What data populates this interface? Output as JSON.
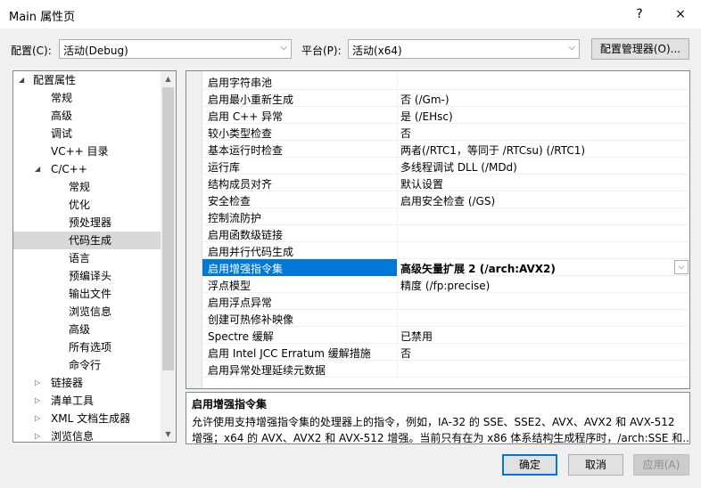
{
  "window": {
    "title": "Main 属性页",
    "help": "?",
    "close": "×"
  },
  "config": {
    "label": "配置(C):",
    "value": "活动(Debug)"
  },
  "platform": {
    "label": "平台(P):",
    "value": "活动(x64)"
  },
  "config_manager_label": "配置管理器(O)...",
  "tree": [
    {
      "label": "配置属性",
      "expander": "◢"
    },
    {
      "label": "常规"
    },
    {
      "label": "高级"
    },
    {
      "label": "调试"
    },
    {
      "label": "VC++ 目录"
    },
    {
      "label": "C/C++",
      "expander": "◢"
    },
    {
      "label": "常规"
    },
    {
      "label": "优化"
    },
    {
      "label": "预处理器"
    },
    {
      "label": "代码生成",
      "selected": true
    },
    {
      "label": "语言"
    },
    {
      "label": "预编译头"
    },
    {
      "label": "输出文件"
    },
    {
      "label": "浏览信息"
    },
    {
      "label": "高级"
    },
    {
      "label": "所有选项"
    },
    {
      "label": "命令行"
    },
    {
      "label": "链接器",
      "expander": "▷"
    },
    {
      "label": "清单工具",
      "expander": "▷"
    },
    {
      "label": "XML 文档生成器",
      "expander": "▷"
    },
    {
      "label": "浏览信息",
      "expander": "▷"
    }
  ],
  "properties": [
    {
      "name": "启用字符串池",
      "value": ""
    },
    {
      "name": "启用最小重新生成",
      "value": "否 (/Gm-)"
    },
    {
      "name": "启用 C++ 异常",
      "value": "是 (/EHsc)"
    },
    {
      "name": "较小类型检查",
      "value": "否"
    },
    {
      "name": "基本运行时检查",
      "value": "两者(/RTC1，等同于 /RTCsu) (/RTC1)"
    },
    {
      "name": "运行库",
      "value": "多线程调试 DLL (/MDd)"
    },
    {
      "name": "结构成员对齐",
      "value": "默认设置"
    },
    {
      "name": "安全检查",
      "value": "启用安全检查 (/GS)"
    },
    {
      "name": "控制流防护",
      "value": ""
    },
    {
      "name": "启用函数级链接",
      "value": ""
    },
    {
      "name": "启用并行代码生成",
      "value": ""
    },
    {
      "name": "启用增强指令集",
      "value": "高级矢量扩展 2 (/arch:AVX2)",
      "selected": true
    },
    {
      "name": "浮点模型",
      "value": "精度 (/fp:precise)"
    },
    {
      "name": "启用浮点异常",
      "value": ""
    },
    {
      "name": "创建可热修补映像",
      "value": ""
    },
    {
      "name": "Spectre 缓解",
      "value": "已禁用"
    },
    {
      "name": "启用 Intel JCC Erratum 缓解措施",
      "value": "否"
    },
    {
      "name": "启用异常处理延续元数据",
      "value": ""
    }
  ],
  "description": {
    "title": "启用增强指令集",
    "line1": "允许使用支持增强指令集的处理器上的指令，例如，IA-32 的 SSE、SSE2、AVX、AVX2 和 AVX-512",
    "line2": "增强；x64 的 AVX、AVX2 和 AVX-512 增强。当前只有在为 x86 体系结构生成程序时，/arch:SSE 和..."
  },
  "buttons": {
    "ok": "确定",
    "cancel": "取消",
    "apply": "应用(A)"
  },
  "icons": {
    "dropdown": "chevron-down-icon",
    "scroll_up": "scroll-up-icon",
    "scroll_down": "scroll-down-icon"
  }
}
